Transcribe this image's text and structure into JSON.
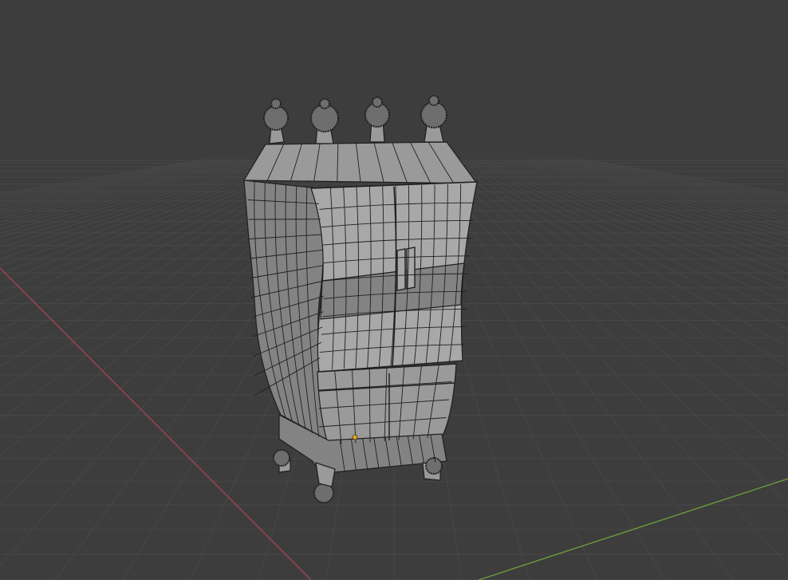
{
  "viewport": {
    "mode": "wireframe-overlay",
    "background_color": "#3d3d3d",
    "grid_color": "#474747",
    "x_axis_color": "#a0444e",
    "y_axis_color": "#6a9a3a"
  },
  "object": {
    "kind": "wardrobe cabinet mesh",
    "body_color": "#9a9a9a",
    "body_light_color": "#a8a8a8",
    "body_dark_color": "#838383",
    "wire_color": "#1f1f1f",
    "origin_color": "#e8a317",
    "finials": 4,
    "feet": 4,
    "doors": 2,
    "drawers": 2
  }
}
